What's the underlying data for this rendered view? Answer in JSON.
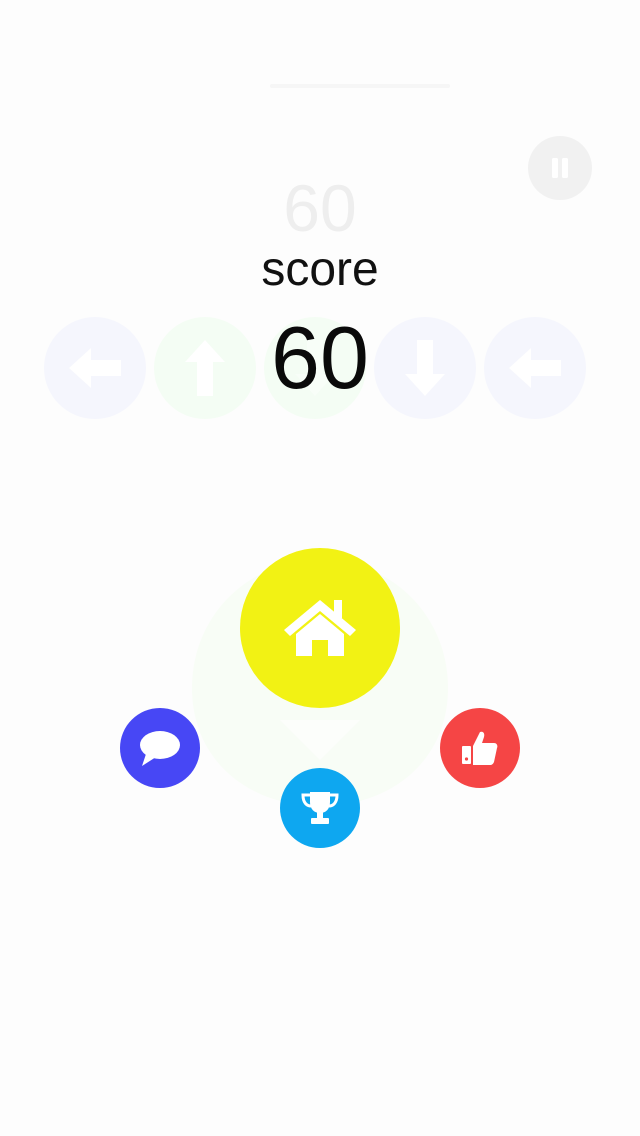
{
  "hud": {
    "ghost_score": "60",
    "pause_icon": "pause-icon"
  },
  "game_over": {
    "score_label": "score",
    "score_value": "60"
  },
  "arrow_tiles": [
    {
      "direction": "left",
      "color": "#f5f6fd",
      "arrow_color": "#ffffff"
    },
    {
      "direction": "up",
      "color": "#f4fdf4",
      "arrow_color": "#ffffff"
    },
    {
      "direction": "down-hidden",
      "color": "#f4fdf4",
      "arrow_color": "#ffffff"
    },
    {
      "direction": "down",
      "color": "#f5f6fd",
      "arrow_color": "#ffffff"
    },
    {
      "direction": "left",
      "color": "#f5f6fd",
      "arrow_color": "#ffffff"
    }
  ],
  "menu": {
    "home": {
      "icon": "home-icon",
      "color": "#f2f214"
    },
    "comment": {
      "icon": "speech-bubble-icon",
      "color": "#4747f5"
    },
    "leaderboard": {
      "icon": "trophy-icon",
      "color": "#0ea7f0"
    },
    "like": {
      "icon": "thumbs-up-icon",
      "color": "#f54545"
    }
  },
  "colors": {
    "background": "#fdfdfd",
    "score_text": "#0a0a0a",
    "ghost_text": "#eeeeee"
  }
}
